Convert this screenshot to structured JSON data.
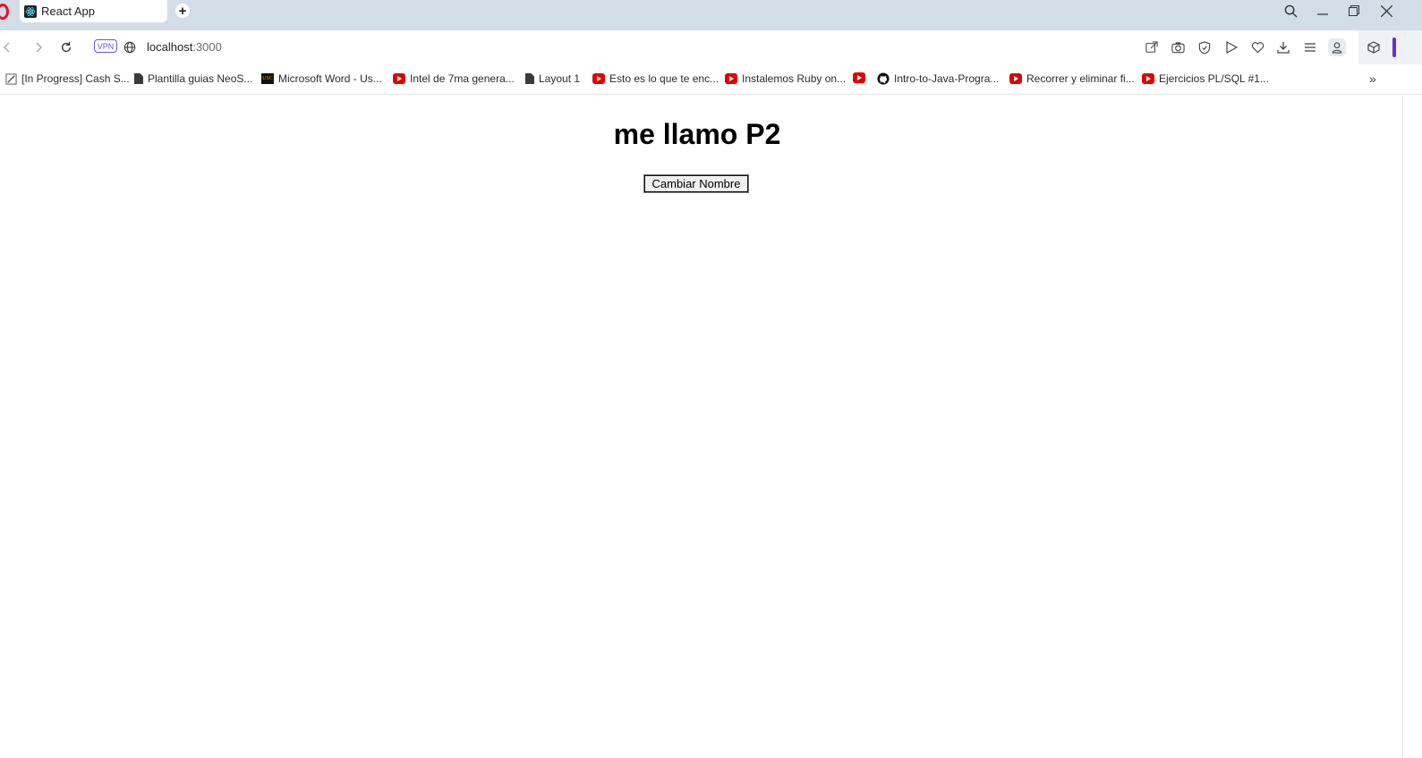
{
  "browser": {
    "tab": {
      "title": "React App",
      "favicon": "react-icon"
    },
    "new_tab_label": "+",
    "address": {
      "host": "localhost",
      "port": ":3000",
      "vpn_label": "VPN"
    },
    "bookmarks": [
      {
        "label": "[In Progress] Cash S...",
        "icon": "edit-icon"
      },
      {
        "label": "Plantilla guias NeoS...",
        "icon": "document-icon"
      },
      {
        "label": "Microsoft Word - Us...",
        "icon": "usc-logo-icon"
      },
      {
        "label": "Intel de 7ma genera...",
        "icon": "youtube-icon"
      },
      {
        "label": "Layout 1",
        "icon": "document-icon"
      },
      {
        "label": "Esto es lo que te enc...",
        "icon": "youtube-icon"
      },
      {
        "label": "Instalemos Ruby on...",
        "icon": "youtube-icon"
      },
      {
        "label": "",
        "icon": "youtube-icon"
      },
      {
        "label": "Intro-to-Java-Progra...",
        "icon": "github-icon"
      },
      {
        "label": "Recorrer y eliminar fi...",
        "icon": "youtube-icon"
      },
      {
        "label": "Ejercicios PL/SQL #1...",
        "icon": "youtube-icon"
      }
    ],
    "colors": {
      "accent": "#6c2bd9",
      "youtube": "#e10000",
      "opera": "#e8112d",
      "chrome_bg": "#d3dde6"
    }
  },
  "page": {
    "heading": "me llamo P2",
    "button_label": "Cambiar Nombre"
  }
}
